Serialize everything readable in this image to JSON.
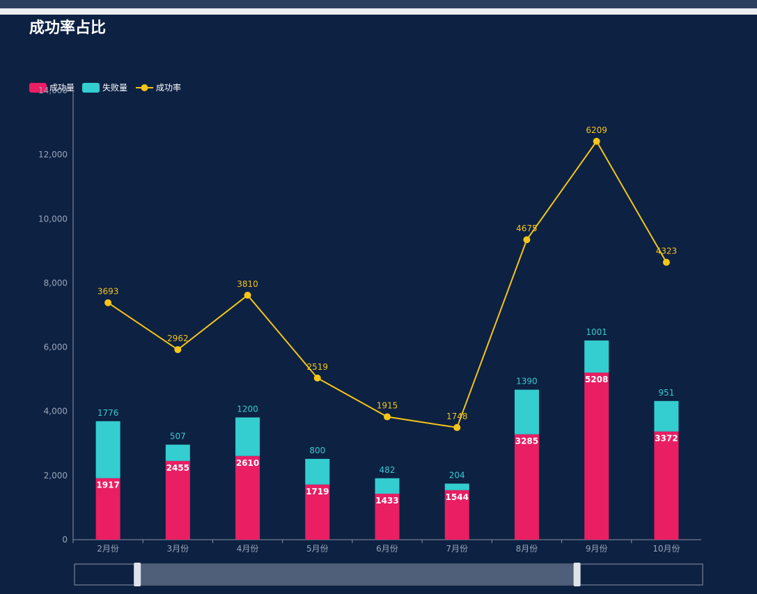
{
  "page": {
    "title": "成功率占比"
  },
  "colors": {
    "background": "#0d2142",
    "success": "#e91e63",
    "fail": "#34cdd0",
    "rate": "#f5c518",
    "axis_text": "#9aa5b8",
    "axis_line": "#8a94a6"
  },
  "chart_data": {
    "type": "bar",
    "stacked": true,
    "categories": [
      "2月份",
      "3月份",
      "4月份",
      "5月份",
      "6月份",
      "7月份",
      "8月份",
      "9月份",
      "10月份"
    ],
    "series": [
      {
        "name": "成功量",
        "type": "bar",
        "values": [
          1917,
          2455,
          2610,
          1719,
          1433,
          1544,
          3285,
          5208,
          3372
        ]
      },
      {
        "name": "失败量",
        "type": "bar",
        "values": [
          1776,
          507,
          1200,
          800,
          482,
          204,
          1390,
          1001,
          951
        ]
      },
      {
        "name": "成功率",
        "type": "line",
        "values": [
          3693,
          2962,
          3810,
          2519,
          1915,
          1748,
          4675,
          6209,
          4323
        ]
      }
    ],
    "yticks": [
      "0",
      "2,000",
      "4,000",
      "6,000",
      "8,000",
      "10,000",
      "12,000",
      "14,000"
    ],
    "ylim": [
      0,
      14000
    ],
    "line_axis_max": 7000,
    "legend_position": "top-left",
    "grid": false,
    "data_zoom": {
      "start": 0.1,
      "end": 0.8
    }
  }
}
